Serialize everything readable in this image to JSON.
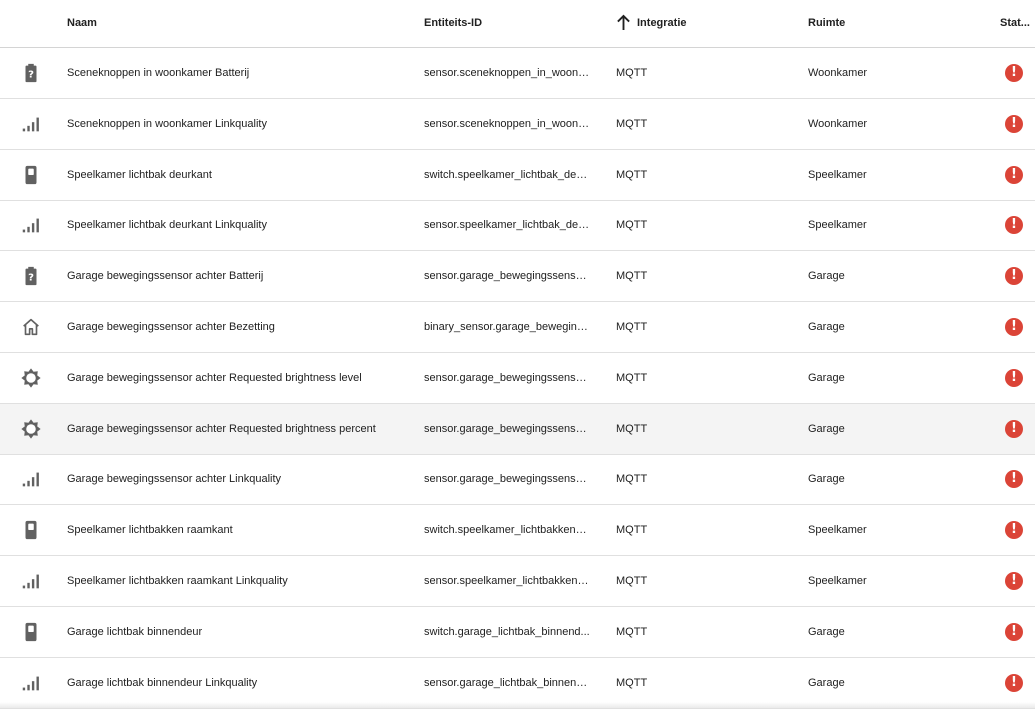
{
  "table": {
    "columns": {
      "name": "Naam",
      "entity_id": "Entiteits-ID",
      "integration": "Integratie",
      "room": "Ruimte",
      "status": "Stat..."
    },
    "sort": {
      "column": "integration",
      "direction": "ascending",
      "icon": "arrow-up-icon"
    },
    "rows": [
      {
        "icon": "battery-unknown-icon",
        "name": "Sceneknoppen in woonkamer Batterij",
        "entity_id": "sensor.sceneknoppen_in_woonk...",
        "integration": "MQTT",
        "room": "Woonkamer",
        "status_icon": "alert-circle-icon",
        "status_glyph": "!"
      },
      {
        "icon": "signal-icon",
        "name": "Sceneknoppen in woonkamer Linkquality",
        "entity_id": "sensor.sceneknoppen_in_woonk...",
        "integration": "MQTT",
        "room": "Woonkamer",
        "status_icon": "alert-circle-icon",
        "status_glyph": "!"
      },
      {
        "icon": "switch-icon",
        "name": "Speelkamer lichtbak deurkant",
        "entity_id": "switch.speelkamer_lichtbak_deu...",
        "integration": "MQTT",
        "room": "Speelkamer",
        "status_icon": "alert-circle-icon",
        "status_glyph": "!"
      },
      {
        "icon": "signal-icon",
        "name": "Speelkamer lichtbak deurkant Linkquality",
        "entity_id": "sensor.speelkamer_lichtbak_deu...",
        "integration": "MQTT",
        "room": "Speelkamer",
        "status_icon": "alert-circle-icon",
        "status_glyph": "!"
      },
      {
        "icon": "battery-unknown-icon",
        "name": "Garage bewegingssensor achter Batterij",
        "entity_id": "sensor.garage_bewegingssensor...",
        "integration": "MQTT",
        "room": "Garage",
        "status_icon": "alert-circle-icon",
        "status_glyph": "!"
      },
      {
        "icon": "home-icon",
        "name": "Garage bewegingssensor achter Bezetting",
        "entity_id": "binary_sensor.garage_beweging...",
        "integration": "MQTT",
        "room": "Garage",
        "status_icon": "alert-circle-icon",
        "status_glyph": "!"
      },
      {
        "icon": "brightness-icon",
        "name": "Garage bewegingssensor achter Requested brightness level",
        "entity_id": "sensor.garage_bewegingssensor...",
        "integration": "MQTT",
        "room": "Garage",
        "status_icon": "alert-circle-icon",
        "status_glyph": "!"
      },
      {
        "icon": "brightness-icon",
        "name": "Garage bewegingssensor achter Requested brightness percent",
        "entity_id": "sensor.garage_bewegingssensor...",
        "integration": "MQTT",
        "room": "Garage",
        "status_icon": "alert-circle-icon",
        "status_glyph": "!",
        "highlighted": true
      },
      {
        "icon": "signal-icon",
        "name": "Garage bewegingssensor achter Linkquality",
        "entity_id": "sensor.garage_bewegingssensor...",
        "integration": "MQTT",
        "room": "Garage",
        "status_icon": "alert-circle-icon",
        "status_glyph": "!"
      },
      {
        "icon": "switch-icon",
        "name": "Speelkamer lichtbakken raamkant",
        "entity_id": "switch.speelkamer_lichtbakken_r...",
        "integration": "MQTT",
        "room": "Speelkamer",
        "status_icon": "alert-circle-icon",
        "status_glyph": "!"
      },
      {
        "icon": "signal-icon",
        "name": "Speelkamer lichtbakken raamkant Linkquality",
        "entity_id": "sensor.speelkamer_lichtbakken_...",
        "integration": "MQTT",
        "room": "Speelkamer",
        "status_icon": "alert-circle-icon",
        "status_glyph": "!"
      },
      {
        "icon": "switch-icon",
        "name": "Garage lichtbak binnendeur",
        "entity_id": "switch.garage_lichtbak_binnend...",
        "integration": "MQTT",
        "room": "Garage",
        "status_icon": "alert-circle-icon",
        "status_glyph": "!"
      },
      {
        "icon": "signal-icon",
        "name": "Garage lichtbak binnendeur Linkquality",
        "entity_id": "sensor.garage_lichtbak_binnend...",
        "integration": "MQTT",
        "room": "Garage",
        "status_icon": "alert-circle-icon",
        "status_glyph": "!"
      }
    ]
  },
  "colors": {
    "error": "#db4437",
    "icon": "#616161",
    "highlight_row": "#f4f4f4"
  }
}
